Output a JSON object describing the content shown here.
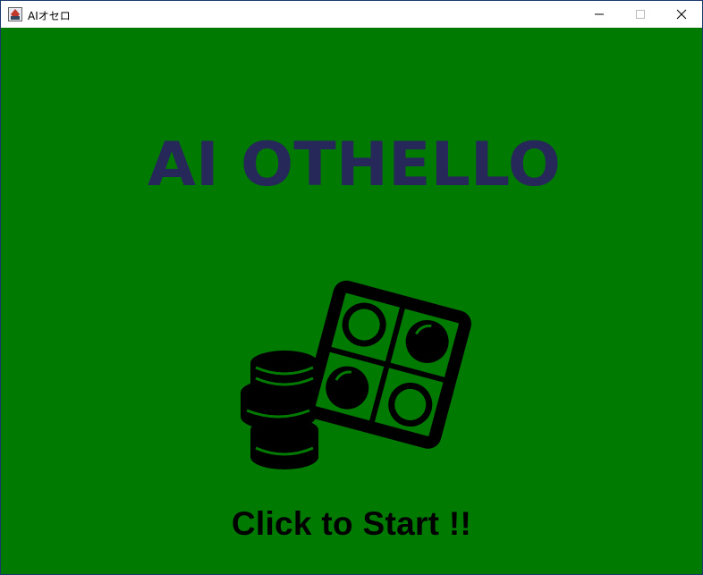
{
  "window": {
    "title": "AIオセロ",
    "controls": {
      "minimize": "minimize-icon",
      "maximize": "maximize-icon",
      "close": "close-icon"
    }
  },
  "screen": {
    "logo_text": "AI OTHELLO",
    "cta_label": "Click to Start !!"
  },
  "colors": {
    "background": "#007a00",
    "logo": "#26285a",
    "illustration": "#000000",
    "cta": "#000000"
  }
}
